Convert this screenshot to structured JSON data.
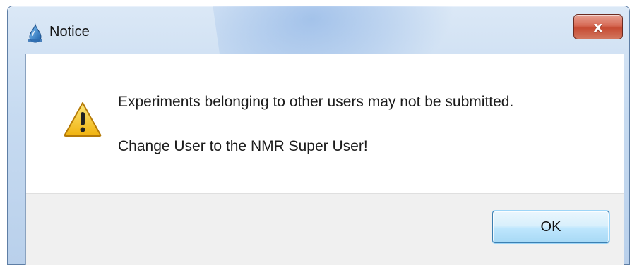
{
  "window": {
    "title": "Notice",
    "app_icon": "water-drop-icon",
    "close_glyph": "x"
  },
  "dialog": {
    "icon": "warning-icon",
    "messages": [
      "Experiments belonging to other users may not be submitted.",
      "Change User to the NMR Super User!"
    ]
  },
  "buttons": {
    "ok_label": "OK"
  },
  "colors": {
    "titlebar": "#c7dbf1",
    "close_button": "#c64b33",
    "warning_fill": "#f3c21b",
    "ok_button_border": "#3c7fb1"
  }
}
